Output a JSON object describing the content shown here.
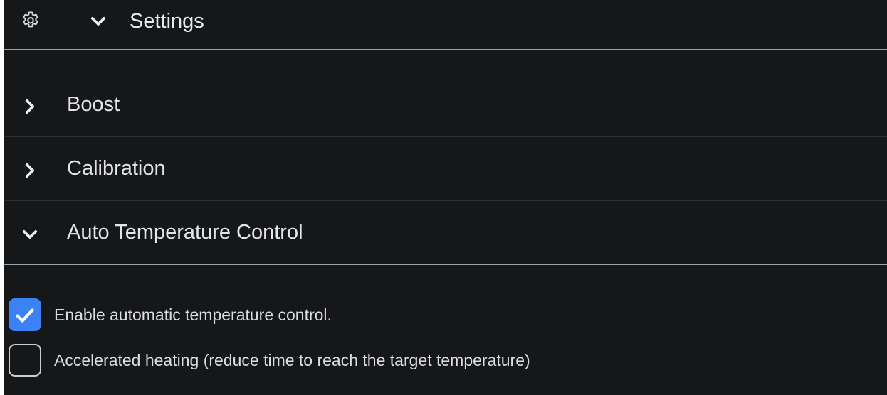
{
  "header": {
    "title": "Settings",
    "icon": "gear-icon",
    "toggle_icon": "chevron-down-icon"
  },
  "sections": [
    {
      "label": "Boost",
      "expanded": false
    },
    {
      "label": "Calibration",
      "expanded": false
    },
    {
      "label": "Auto Temperature Control",
      "expanded": true
    }
  ],
  "auto_temperature_control": {
    "options": [
      {
        "label": "Enable automatic temperature control.",
        "checked": true
      },
      {
        "label": "Accelerated heating (reduce time to reach the target temperature)",
        "checked": false
      }
    ]
  },
  "colors": {
    "background": "#161719",
    "divider": "#9aa2ad",
    "checkbox_accent": "#3b82f6",
    "text": "#e6e7ea"
  }
}
